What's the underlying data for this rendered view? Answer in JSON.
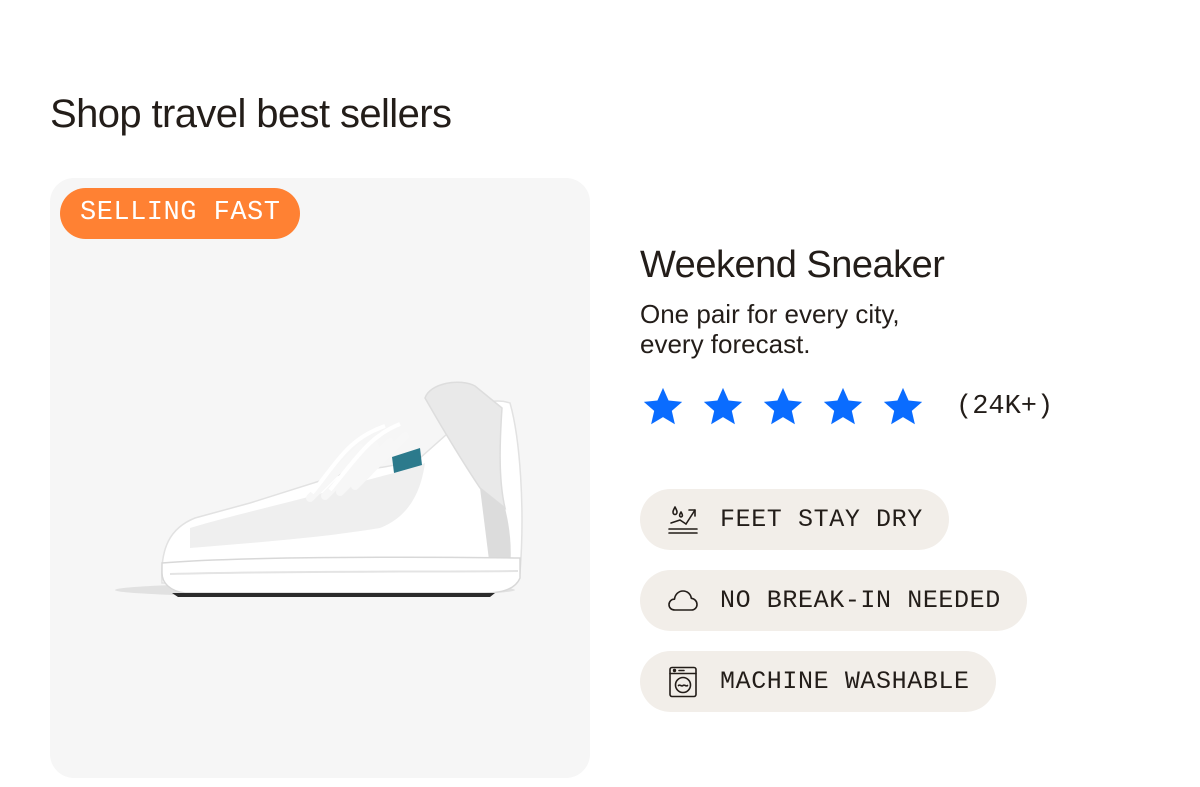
{
  "section": {
    "title": "Shop travel best sellers"
  },
  "product": {
    "badge": "SELLING FAST",
    "name": "Weekend Sneaker",
    "tagline_line1": "One pair for every city,",
    "tagline_line2": "every forecast.",
    "rating": {
      "stars": 5,
      "max_stars": 5,
      "count_label": "(24K+)",
      "star_color": "#0a6cff"
    },
    "features": [
      {
        "icon": "water-drops-icon",
        "label": "FEET STAY DRY"
      },
      {
        "icon": "cloud-icon",
        "label": "NO BREAK-IN NEEDED"
      },
      {
        "icon": "washing-machine-icon",
        "label": "MACHINE WASHABLE"
      }
    ]
  },
  "colors": {
    "badge_bg": "#ff8133",
    "pill_bg": "#f2eee9",
    "card_bg": "#f6f6f6",
    "text": "#231d19"
  }
}
